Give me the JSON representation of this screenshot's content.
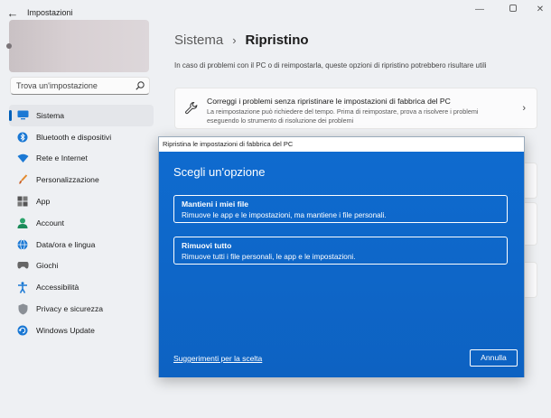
{
  "window": {
    "title": "Impostazioni",
    "back_glyph": "←",
    "minimize_glyph": "—",
    "close_glyph": "✕"
  },
  "search": {
    "value": "Trova un'impostazione",
    "icon": "search-icon"
  },
  "sidebar": {
    "items": [
      {
        "label": "Sistema",
        "icon": "monitor-icon",
        "active": true
      },
      {
        "label": "Bluetooth e dispositivi",
        "icon": "bluetooth-icon"
      },
      {
        "label": "Rete e Internet",
        "icon": "wifi-icon"
      },
      {
        "label": "Personalizzazione",
        "icon": "brush-icon"
      },
      {
        "label": "App",
        "icon": "apps-icon"
      },
      {
        "label": "Account",
        "icon": "account-icon"
      },
      {
        "label": "Data/ora e lingua",
        "icon": "globe-clock-icon"
      },
      {
        "label": "Giochi",
        "icon": "gamepad-icon"
      },
      {
        "label": "Accessibilità",
        "icon": "accessibility-icon"
      },
      {
        "label": "Privacy e sicurezza",
        "icon": "shield-icon"
      },
      {
        "label": "Windows Update",
        "icon": "update-icon"
      }
    ]
  },
  "breadcrumb": {
    "parent": "Sistema",
    "separator": "›",
    "current": "Ripristino"
  },
  "intro": "In caso di problemi con il PC o di reimpostarla, queste opzioni di ripristino potrebbero risultare utili",
  "card": {
    "title": "Correggi i problemi senza ripristinare le impostazioni di fabbrica del PC",
    "description": "La reimpostazione può richiedere del tempo. Prima di reimpostare, prova a risolvere i problemi eseguendo lo strumento di risoluzione dei problemi",
    "icon": "wrench-icon",
    "chevron": "›"
  },
  "dialog": {
    "title": "Ripristina le impostazioni di fabbrica del PC",
    "heading": "Scegli un'opzione",
    "options": [
      {
        "title": "Mantieni i miei file",
        "description": "Rimuove le app e le impostazioni, ma mantiene i file personali."
      },
      {
        "title": "Rimuovi tutto",
        "description": "Rimuove tutti i file personali, le app e le impostazioni."
      }
    ],
    "help_link": "Suggerimenti per la scelta",
    "cancel_button": "Annulla"
  },
  "colors": {
    "accent": "#005fb8",
    "dialog_blue": "#0f67c8"
  }
}
